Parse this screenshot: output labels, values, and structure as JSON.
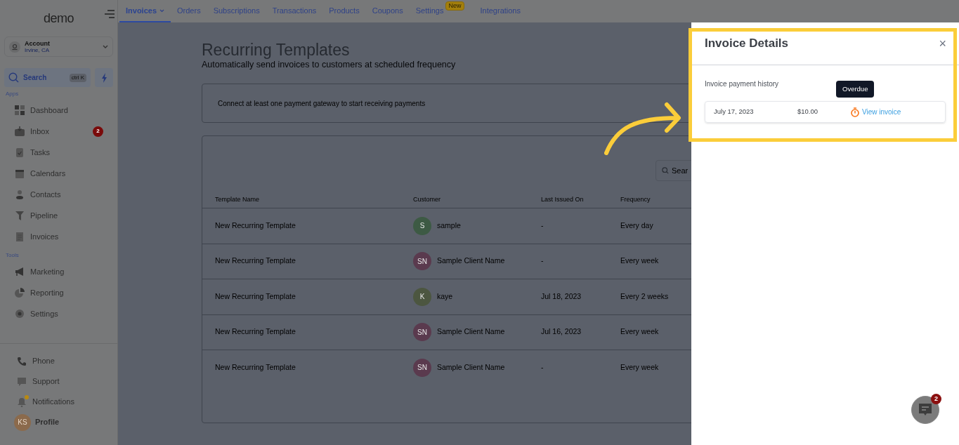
{
  "sidebar": {
    "logo": "demo",
    "account": {
      "name": "Account",
      "location": "Irvine, CA"
    },
    "search": {
      "label": "Search",
      "shortcut": "ctrl K"
    },
    "sections": [
      {
        "title": "Apps",
        "items": [
          {
            "label": "Dashboard"
          },
          {
            "label": "Inbox",
            "badge": "2"
          },
          {
            "label": "Tasks"
          },
          {
            "label": "Calendars"
          },
          {
            "label": "Contacts"
          },
          {
            "label": "Pipeline"
          },
          {
            "label": "Invoices"
          }
        ]
      },
      {
        "title": "Tools",
        "items": [
          {
            "label": "Marketing"
          },
          {
            "label": "Reporting"
          },
          {
            "label": "Settings"
          }
        ]
      }
    ],
    "bottom": [
      {
        "label": "Phone"
      },
      {
        "label": "Support"
      },
      {
        "label": "Notifications",
        "dot": true
      },
      {
        "label": "Profile",
        "initials": "KS"
      }
    ]
  },
  "tabs": [
    {
      "label": "Invoices",
      "selected": true,
      "dropdown": true
    },
    {
      "label": "Orders",
      "selected": false
    },
    {
      "label": "Subscriptions",
      "selected": false
    },
    {
      "label": "Transactions",
      "selected": false
    },
    {
      "label": "Products",
      "selected": false
    },
    {
      "label": "Coupons",
      "selected": false
    },
    {
      "label": "Settings",
      "selected": false,
      "badge": "New"
    },
    {
      "label": "Integrations",
      "selected": false
    }
  ],
  "page": {
    "title": "Recurring Templates",
    "subtitle": "Automatically send invoices to customers at scheduled frequency",
    "banner": "Connect at least one payment gateway to start receiving payments",
    "search_placeholder": "Sear"
  },
  "table": {
    "columns": [
      "Template Name",
      "Customer",
      "Last Issued On",
      "Frequency"
    ],
    "rows": [
      {
        "template": "New Recurring Template",
        "initials": "S",
        "customer": "sample",
        "color": "#3d5a44",
        "last_issued": "-",
        "frequency": "Every day"
      },
      {
        "template": "New Recurring Template",
        "initials": "SN",
        "customer": "Sample Client Name",
        "color": "#5a3a4e",
        "last_issued": "-",
        "frequency": "Every week"
      },
      {
        "template": "New Recurring Template",
        "initials": "K",
        "customer": "kaye",
        "color": "#4c5640",
        "last_issued": "Jul 18, 2023",
        "frequency": "Every 2 weeks"
      },
      {
        "template": "New Recurring Template",
        "initials": "SN",
        "customer": "Sample Client Name",
        "color": "#5a3a4e",
        "last_issued": "Jul 16, 2023",
        "frequency": "Every week"
      },
      {
        "template": "New Recurring Template",
        "initials": "SN",
        "customer": "Sample Client Name",
        "color": "#5a3a4e",
        "last_issued": "-",
        "frequency": "Every week"
      }
    ]
  },
  "drawer": {
    "title": "Invoice Details",
    "close": "×",
    "section": "Invoice payment history",
    "payments": [
      {
        "date": "July 17, 2023",
        "amount": "$10.00",
        "tooltip": "Overdue",
        "link": "View invoice"
      }
    ]
  },
  "chat": {
    "badge": "2"
  }
}
